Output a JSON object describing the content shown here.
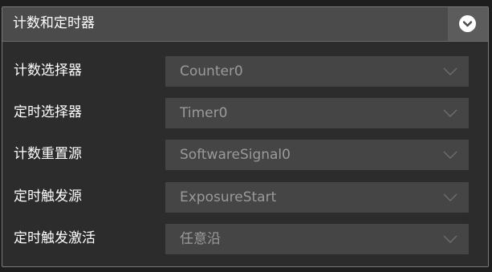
{
  "panel": {
    "title": "计数和定时器",
    "collapse_icon": "chevron-down-circle-icon"
  },
  "rows": [
    {
      "label": "计数选择器",
      "value": "Counter0"
    },
    {
      "label": "定时选择器",
      "value": "Timer0"
    },
    {
      "label": "计数重置源",
      "value": "SoftwareSignal0"
    },
    {
      "label": "定时触发源",
      "value": "ExposureStart"
    },
    {
      "label": "定时触发激活",
      "value": "任意沿"
    }
  ],
  "colors": {
    "background": "#2c2c2c",
    "header": "#4b4b4b",
    "select": "#454545",
    "value_text": "#9a9a9a",
    "label_text": "#ffffff"
  }
}
